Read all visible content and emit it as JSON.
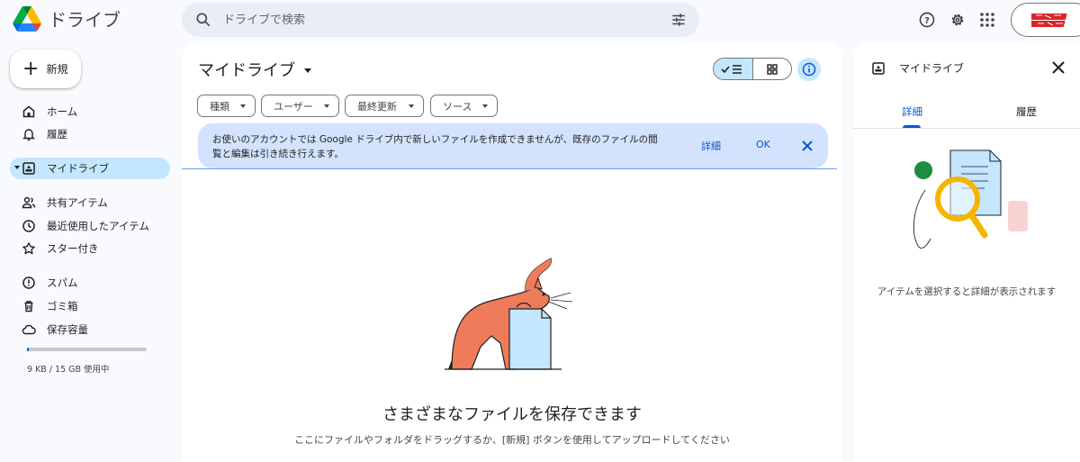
{
  "app": {
    "name": "ドライブ",
    "logo_colors": [
      "#0066da",
      "#00ac47",
      "#ea4335",
      "#00832d",
      "#2684fc",
      "#ffba00"
    ]
  },
  "search": {
    "placeholder": "ドライブで検索"
  },
  "header_icons": [
    "help-icon",
    "settings-icon",
    "apps-icon"
  ],
  "left_nav": {
    "new_label": "新規",
    "items": [
      {
        "label": "ホーム",
        "icon": "home-icon"
      },
      {
        "label": "履歴",
        "icon": "bell-icon"
      },
      {
        "label": "マイドライブ",
        "icon": "my-drive-icon",
        "active": true
      },
      {
        "label": "共有アイテム",
        "icon": "people-icon"
      },
      {
        "label": "最近使用したアイテム",
        "icon": "clock-icon"
      },
      {
        "label": "スター付き",
        "icon": "star-icon"
      },
      {
        "label": "スパム",
        "icon": "spam-icon"
      },
      {
        "label": "ゴミ箱",
        "icon": "trash-icon"
      },
      {
        "label": "保存容量",
        "icon": "cloud-icon"
      }
    ],
    "storage_text": "9 KB / 15 GB 使用中",
    "storage_used_fraction": 0.0006
  },
  "main": {
    "title": "マイドライブ",
    "filters": [
      "種類",
      "ユーザー",
      "最終更新",
      "ソース"
    ],
    "banner": {
      "message": "お使いのアカウントでは Google ドライブ内で新しいファイルを作成できませんが、既存のファイルの閲覧と編集は引き続き行えます。",
      "details_label": "詳細",
      "ok_label": "OK"
    },
    "empty_title": "さまざまなファイルを保存できます",
    "empty_subtitle": "ここにファイルやフォルダをドラッグするか、[新規] ボタンを使用してアップロードしてください"
  },
  "details_panel": {
    "title": "マイドライブ",
    "tabs": [
      "詳細",
      "履歴"
    ],
    "message": "アイテムを選択すると詳細が表示されます"
  },
  "colors": {
    "accent": "#0b57d0",
    "active_bg": "#c2e7ff",
    "banner_bg": "#d3e3fd",
    "cat": "#ee7c5a"
  }
}
